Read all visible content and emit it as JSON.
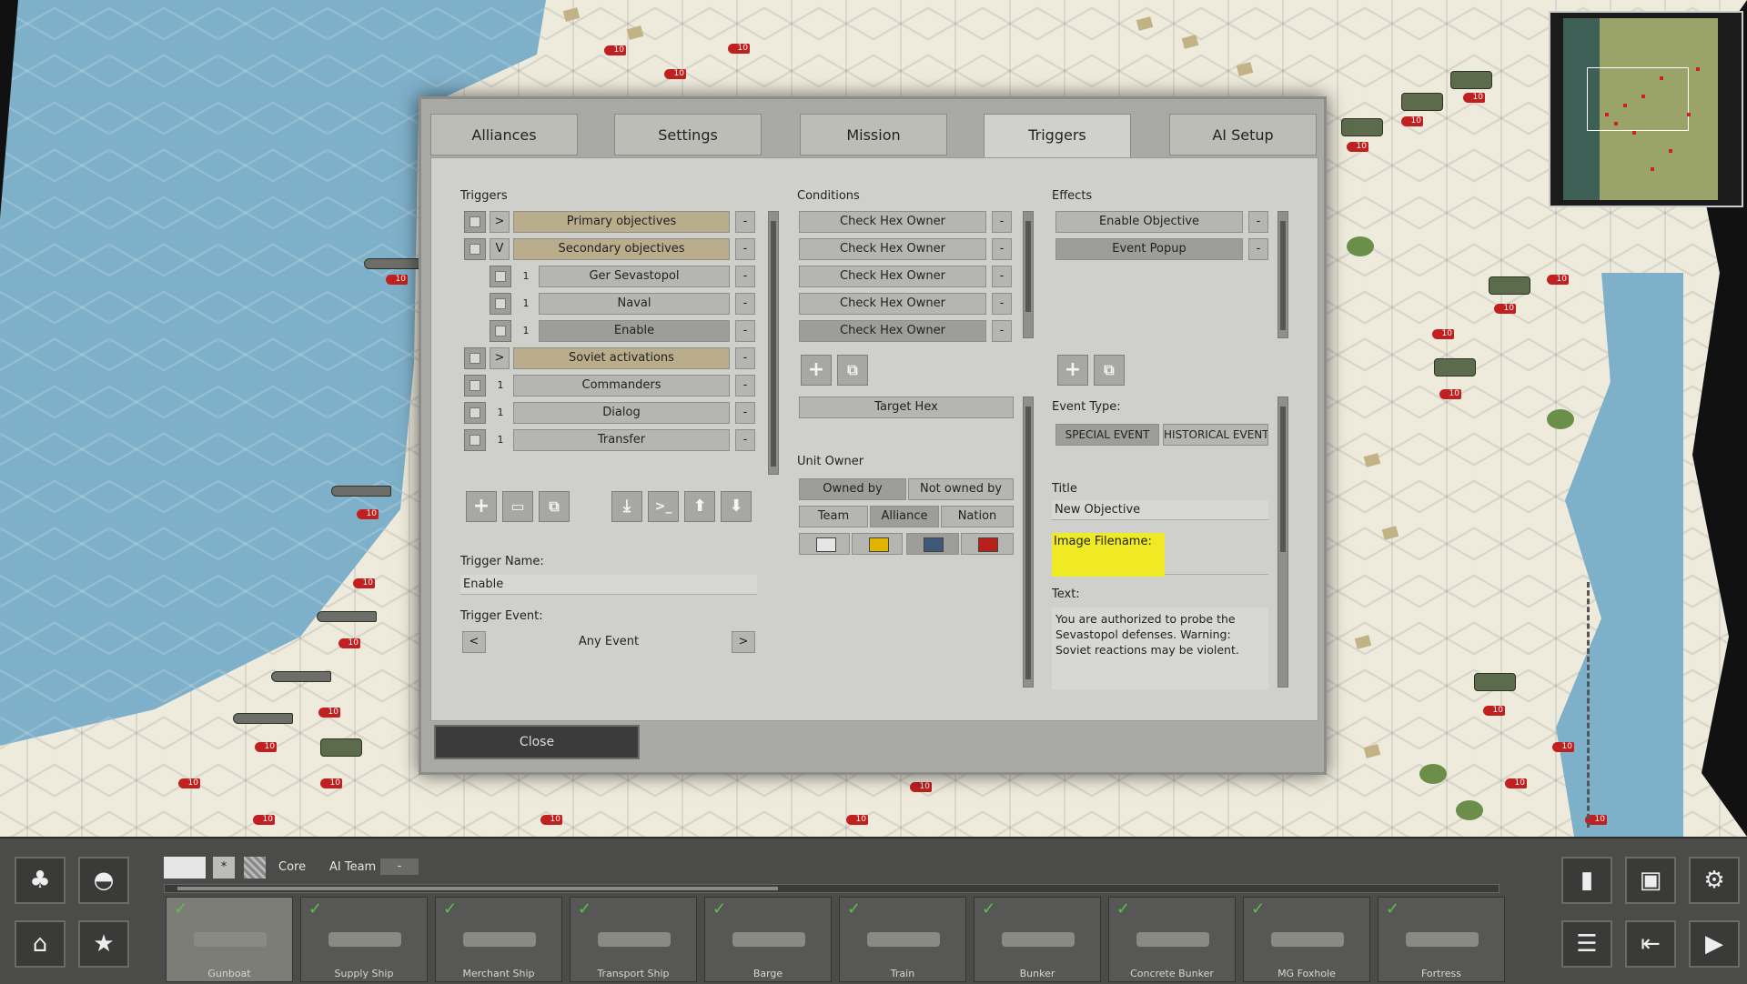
{
  "tabs": [
    {
      "label": "Alliances",
      "active": false
    },
    {
      "label": "Settings",
      "active": false
    },
    {
      "label": "Mission",
      "active": false
    },
    {
      "label": "Triggers",
      "active": true
    },
    {
      "label": "AI Setup",
      "active": false
    }
  ],
  "triggers": {
    "label": "Triggers",
    "rows": [
      {
        "toggle": ">",
        "label": "Primary objectives",
        "style": "gold",
        "indent": false
      },
      {
        "toggle": "V",
        "label": "Secondary objectives",
        "style": "gold",
        "indent": false
      },
      {
        "toggle": "1",
        "label": "Ger Sevastopol",
        "style": "normal",
        "indent": true
      },
      {
        "toggle": "1",
        "label": "Naval",
        "style": "normal",
        "indent": true
      },
      {
        "toggle": "1",
        "label": "Enable",
        "style": "dark",
        "indent": true
      },
      {
        "toggle": ">",
        "label": "Soviet activations",
        "style": "gold",
        "indent": false
      },
      {
        "toggle": "1",
        "label": "Commanders",
        "style": "normal",
        "indent": false
      },
      {
        "toggle": "1",
        "label": "Dialog",
        "style": "normal",
        "indent": false
      },
      {
        "toggle": "1",
        "label": "Transfer",
        "style": "normal",
        "indent": false
      }
    ],
    "remove_label": "-",
    "trigger_name_label": "Trigger Name:",
    "trigger_name_value": "Enable",
    "trigger_event_label": "Trigger Event:",
    "trigger_event_value": "Any Event",
    "prev": "<",
    "next": ">"
  },
  "conditions": {
    "label": "Conditions",
    "rows": [
      "Check Hex Owner",
      "Check Hex Owner",
      "Check Hex Owner",
      "Check Hex Owner",
      "Check Hex Owner"
    ],
    "target_hex": "Target Hex",
    "unit_owner_label": "Unit Owner",
    "owned_by": "Owned by",
    "not_owned_by": "Not owned by",
    "team": "Team",
    "alliance": "Alliance",
    "nation": "Nation",
    "swatches": [
      "#e6e6e6",
      "#e1b400",
      "#3e5878",
      "#b8201c"
    ]
  },
  "effects": {
    "label": "Effects",
    "rows": [
      "Enable Objective",
      "Event Popup"
    ],
    "event_type_label": "Event Type:",
    "special_event": "SPECIAL EVENT",
    "historical_event": "HISTORICAL EVENT",
    "title_label": "Title",
    "title_value": "New Objective",
    "image_filename_label": "Image Filename:",
    "image_filename_value": "",
    "text_label": "Text:",
    "text_value": "You are authorized to probe the Sevastopol defenses. Warning: Soviet reactions may be violent."
  },
  "close_label": "Close",
  "toolbar": {
    "core_label": "Core",
    "ai_team_label": "AI Team",
    "ai_team_value": "-",
    "star_label": "*"
  },
  "units": [
    {
      "label": "Gunboat",
      "selected": true
    },
    {
      "label": "Supply Ship",
      "selected": false
    },
    {
      "label": "Merchant Ship",
      "selected": false
    },
    {
      "label": "Transport Ship",
      "selected": false
    },
    {
      "label": "Barge",
      "selected": false
    },
    {
      "label": "Train",
      "selected": false
    },
    {
      "label": "Bunker",
      "selected": false
    },
    {
      "label": "Concrete Bunker",
      "selected": false
    },
    {
      "label": "MG Foxhole",
      "selected": false
    },
    {
      "label": "Fortress",
      "selected": false
    }
  ],
  "map_badge": "10",
  "colors": {
    "highlight": "#f0ea24",
    "gold_button": "#b9ad8c",
    "check_green": "#5ac24a"
  }
}
